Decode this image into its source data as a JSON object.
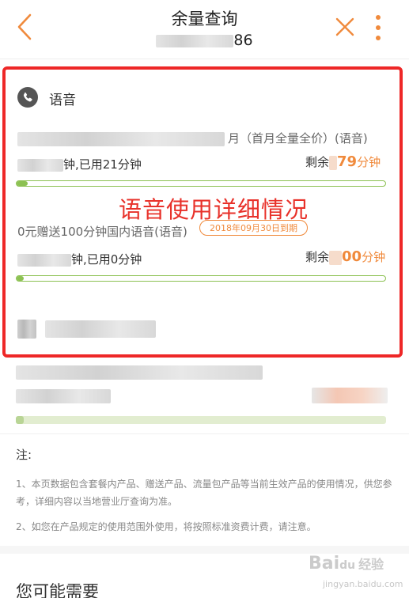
{
  "header": {
    "title": "余量查询",
    "phone_suffix": "86"
  },
  "voice": {
    "section_label": "语音",
    "packages": [
      {
        "name_suffix": "月（首月全量全价）(语音)",
        "usage_suffix": "钟,已用21分钟",
        "remain_prefix": "剩余",
        "remain_value": "79",
        "remain_unit": "分钟",
        "used_fraction": 0.03
      },
      {
        "name": "0元赠送100分钟国内语音(语音)",
        "expiry": "2018年09月30日到期",
        "usage_suffix": "钟,已用0分钟",
        "remain_prefix": "剩余",
        "remain_value": "00",
        "remain_unit": "分钟",
        "used_fraction": 0.0
      }
    ]
  },
  "annotation": {
    "caption": "语音使用详细情况"
  },
  "notes": {
    "title": "注:",
    "items": [
      "1、本页数据包含套餐内产品、赠送产品、流量包产品等当前生效产品的使用情况，供您参考，详细内容以当地营业厅查询为准。",
      "2、如您在产品规定的使用范围外使用，将按照标准资费计费，请注意。"
    ]
  },
  "more": {
    "title": "您可能需要"
  },
  "watermark": {
    "brand": "Bai",
    "brand_tail": "经验",
    "url": "jingyan.baidu.com"
  },
  "colors": {
    "accent_orange": "#f08a3c",
    "progress_green": "#8cc152",
    "highlight_red": "#ee2727"
  }
}
